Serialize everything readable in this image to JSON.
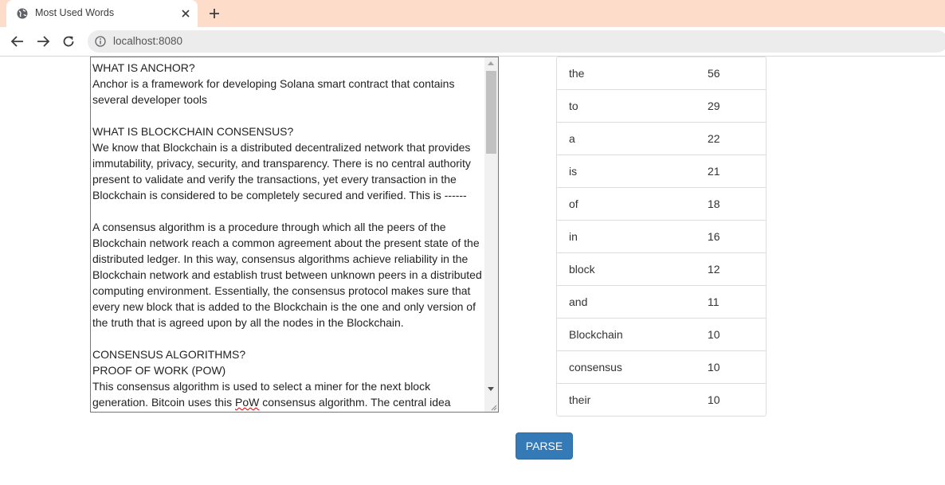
{
  "browser": {
    "tab_title": "Most Used Words",
    "url": "localhost:8080"
  },
  "editor": {
    "lines_before_pow": "WHAT IS ANCHOR?\nAnchor is a framework for developing Solana smart contract that contains several developer tools\n\nWHAT IS BLOCKCHAIN CONSENSUS?\nWe know that Blockchain is a distributed decentralized network that provides immutability, privacy, security, and transparency. There is no central authority present to validate and verify the transactions, yet every transaction in the Blockchain is considered to be completely secured and verified. This is ------\n\nA consensus algorithm is a procedure through which all the peers of the Blockchain network reach a common agreement about the present state of the distributed ledger. In this way, consensus algorithms achieve reliability in the Blockchain network and establish trust between unknown peers in a distributed computing environment. Essentially, the consensus protocol makes sure that every new block that is added to the Blockchain is the one and only version of the truth that is agreed upon by all the nodes in the Blockchain.\n\nCONSENSUS ALGORITHMS?\nPROOF OF WORK (POW)\nThis consensus algorithm is used to select a miner for the next block generation. Bitcoin uses this ",
    "misspelled_word": "PoW",
    "lines_after_pow": " consensus algorithm. The central idea"
  },
  "word_counts": [
    {
      "word": "the",
      "count": "56"
    },
    {
      "word": "to",
      "count": "29"
    },
    {
      "word": "a",
      "count": "22"
    },
    {
      "word": "is",
      "count": "21"
    },
    {
      "word": "of",
      "count": "18"
    },
    {
      "word": "in",
      "count": "16"
    },
    {
      "word": "block",
      "count": "12"
    },
    {
      "word": "and",
      "count": "11"
    },
    {
      "word": "Blockchain",
      "count": "10"
    },
    {
      "word": "consensus",
      "count": "10"
    },
    {
      "word": "their",
      "count": "10"
    }
  ],
  "parse_button_label": "PARSE",
  "colors": {
    "tabstrip": "#fddcc9",
    "button": "#337ab7"
  }
}
